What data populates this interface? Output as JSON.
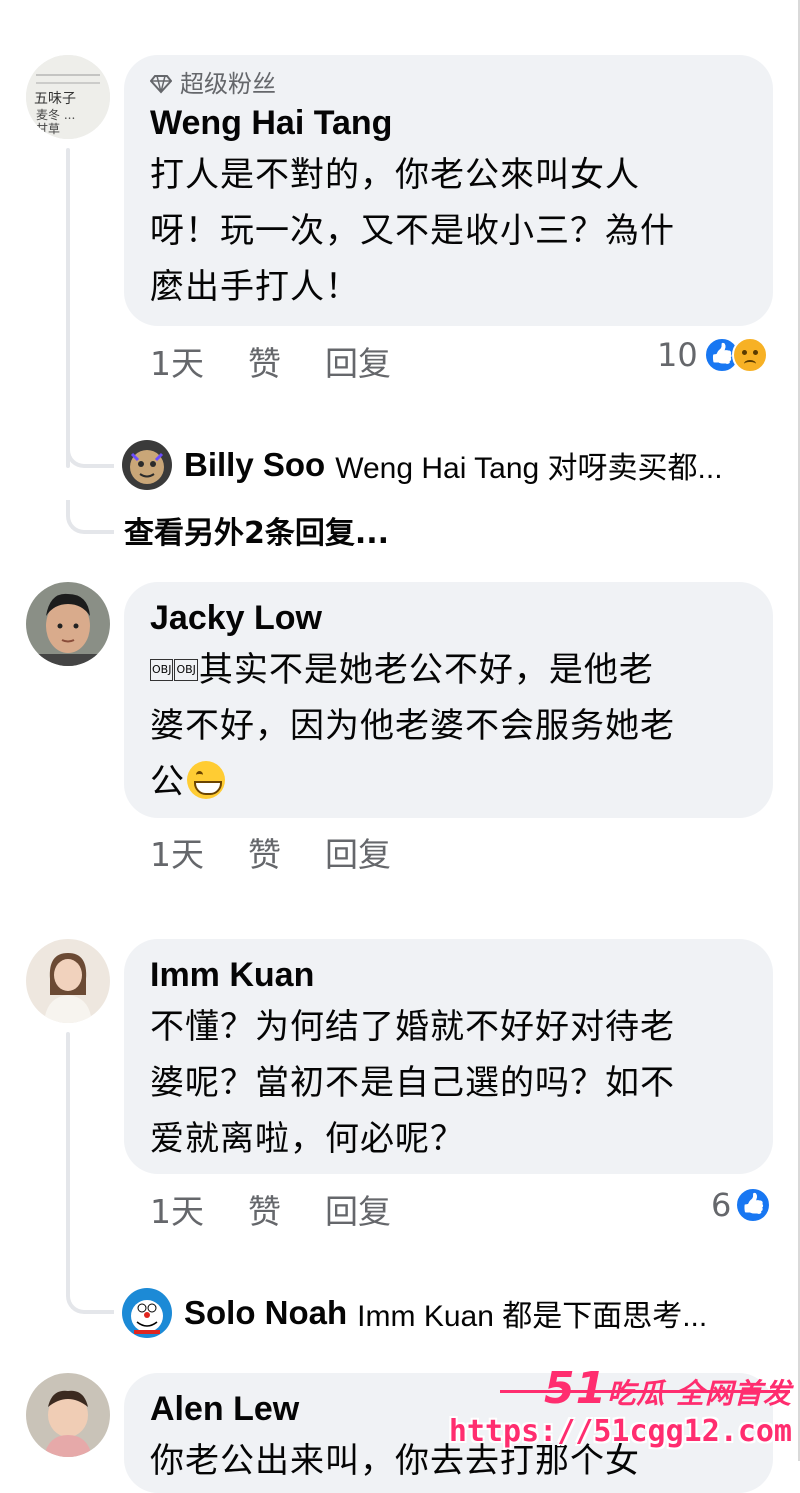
{
  "comments": [
    {
      "badge": "超级粉丝",
      "badge_icon": "diamond-icon",
      "name": "Weng Hai Tang",
      "text": "打人是不對的，你老公來叫女人\n呀！玩一次，又不是收小三？為什\n麼出手打人！",
      "time": "1天",
      "like_label": "赞",
      "reply_label": "回复",
      "reaction_count": "10",
      "reactions": [
        "like-icon",
        "sad-icon"
      ],
      "reply": {
        "name": "Billy Soo",
        "text": "Weng Hai Tang 对呀卖买都..."
      },
      "view_more": "查看另外2条回复..."
    },
    {
      "name": "Jacky Low",
      "obj1": "OBJ",
      "obj2": "OBJ",
      "text": "其实不是她老公不好，是他老\n婆不好，因为他老婆不会服务她老\n公",
      "emoji": "grin-emoji",
      "time": "1天",
      "like_label": "赞",
      "reply_label": "回复"
    },
    {
      "name": "Imm Kuan",
      "text": "不懂？为何结了婚就不好好对待老\n婆呢？當初不是自己選的吗？如不\n爱就离啦，何必呢？",
      "time": "1天",
      "like_label": "赞",
      "reply_label": "回复",
      "reaction_count": "6",
      "reactions": [
        "like-icon"
      ],
      "reply": {
        "name": "Solo Noah",
        "text": "Imm Kuan 都是下面思考..."
      }
    },
    {
      "name": "Alen Lew",
      "text": "你老公出来叫，你去去打那个女"
    }
  ],
  "watermark": {
    "brand_number": "51",
    "brand_text": "吃瓜 全网首发",
    "url": "https://51cgg12.com"
  }
}
